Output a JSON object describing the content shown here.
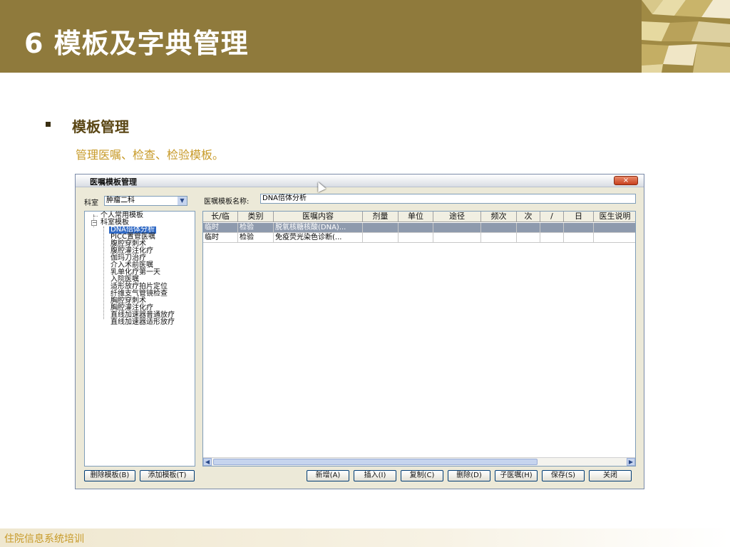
{
  "header": {
    "title": "6 模板及字典管理"
  },
  "bullet": {
    "title": "模板管理",
    "subtitle": "管理医嘱、检查、检验模板。"
  },
  "window": {
    "title": "医嘱模板管理",
    "close": "×",
    "dept_label": "科室",
    "dept_value": "肿瘤二科",
    "template_name_label": "医嘱模板名称:",
    "template_name_value": "DNA倍体分析",
    "tree": {
      "nodes": [
        "个人常用模板",
        "科室模板",
        "DNA倍体分析",
        "PICC置管医嘱",
        "腹腔穿刺术",
        "腹腔灌注化疗",
        "伽玛刀治疗",
        "介入术前医嘱",
        "乳单化疗第一天",
        "入院医嘱",
        "适形放疗拍片定位",
        "纤维支气管镜检查",
        "胸腔穿刺术",
        "胸腔灌注化疗",
        "直线加速器普通放疗",
        "直线加速器适形放疗"
      ]
    },
    "grid": {
      "columns": [
        "长/临",
        "类别",
        "医嘱内容",
        "剂量",
        "单位",
        "途径",
        "频次",
        "次",
        "/",
        "日",
        "医生说明"
      ],
      "rows": [
        [
          "临时",
          "检验",
          "脱氧核糖核酸(DNA)...",
          "",
          "",
          "",
          "",
          "",
          "",
          "",
          ""
        ],
        [
          "临时",
          "检验",
          "免疫荧光染色诊断(...",
          "",
          "",
          "",
          "",
          "",
          "",
          "",
          ""
        ]
      ]
    },
    "buttons": {
      "delete_template": "删除模板(B)",
      "add_template": "添加模板(T)",
      "new": "新增(A)",
      "insert": "插入(I)",
      "copy": "复制(C)",
      "delete": "删除(D)",
      "sub_order": "子医嘱(H)",
      "save": "保存(S)",
      "close": "关闭"
    }
  },
  "footer": {
    "text": "住院信息系统培训"
  },
  "colors": {
    "header": "#8f7a3c",
    "accent_text": "#c79a28",
    "selection": "#316ac5"
  }
}
